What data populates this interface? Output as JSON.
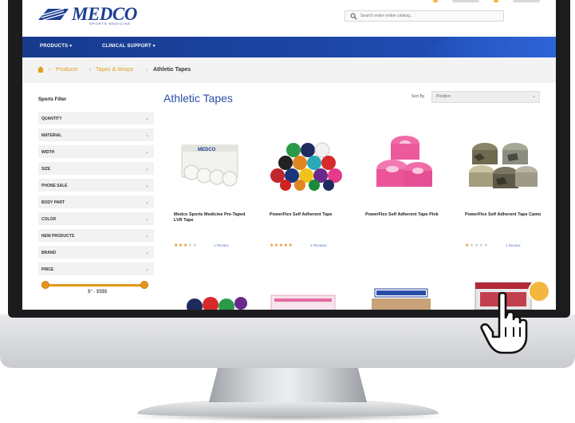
{
  "brand": {
    "name": "MEDCO",
    "tagline": "SPORTS MEDICINE",
    "color": "#1c3f93"
  },
  "search": {
    "placeholder": "Search entire online catalog..."
  },
  "nav": {
    "items": [
      {
        "label": "PRODUCTS ▾"
      },
      {
        "label": "CLINICAL SUPPORT ▾"
      }
    ]
  },
  "breadcrumb": {
    "items": [
      "Products",
      "Tapes & Wraps",
      "Athletic Tapes"
    ]
  },
  "filter": {
    "title": "Sports Filter",
    "rows": [
      "QUANTITY",
      "MATERIAL",
      "WIDTH",
      "SIZE",
      "PHONE SALE",
      "BODY PART",
      "COLOR",
      "NEW PRODUCTS",
      "BRAND",
      "PRICE"
    ],
    "price_range_label": "$* - $$$$"
  },
  "main": {
    "title": "Athletic Tapes",
    "sort_label": "Sort By",
    "sort_value": "Position"
  },
  "products": [
    {
      "name": "Medco Sports Medicine Pre-Taped LVR Tape",
      "rating": 3,
      "reviews": "1 Review"
    },
    {
      "name": "PowerFlex Self Adherent Tape",
      "rating": 5,
      "reviews": "3 Reviews"
    },
    {
      "name": "PowerFlex Self Adherent Tape Pink",
      "rating": 0,
      "reviews": ""
    },
    {
      "name": "PowerFlex Self Adherent Tape Camo",
      "rating": 1,
      "reviews": "1 Review"
    }
  ],
  "colors": {
    "accent": "#e0a020",
    "nav": "#1d47a8",
    "star": "#e8931a"
  }
}
